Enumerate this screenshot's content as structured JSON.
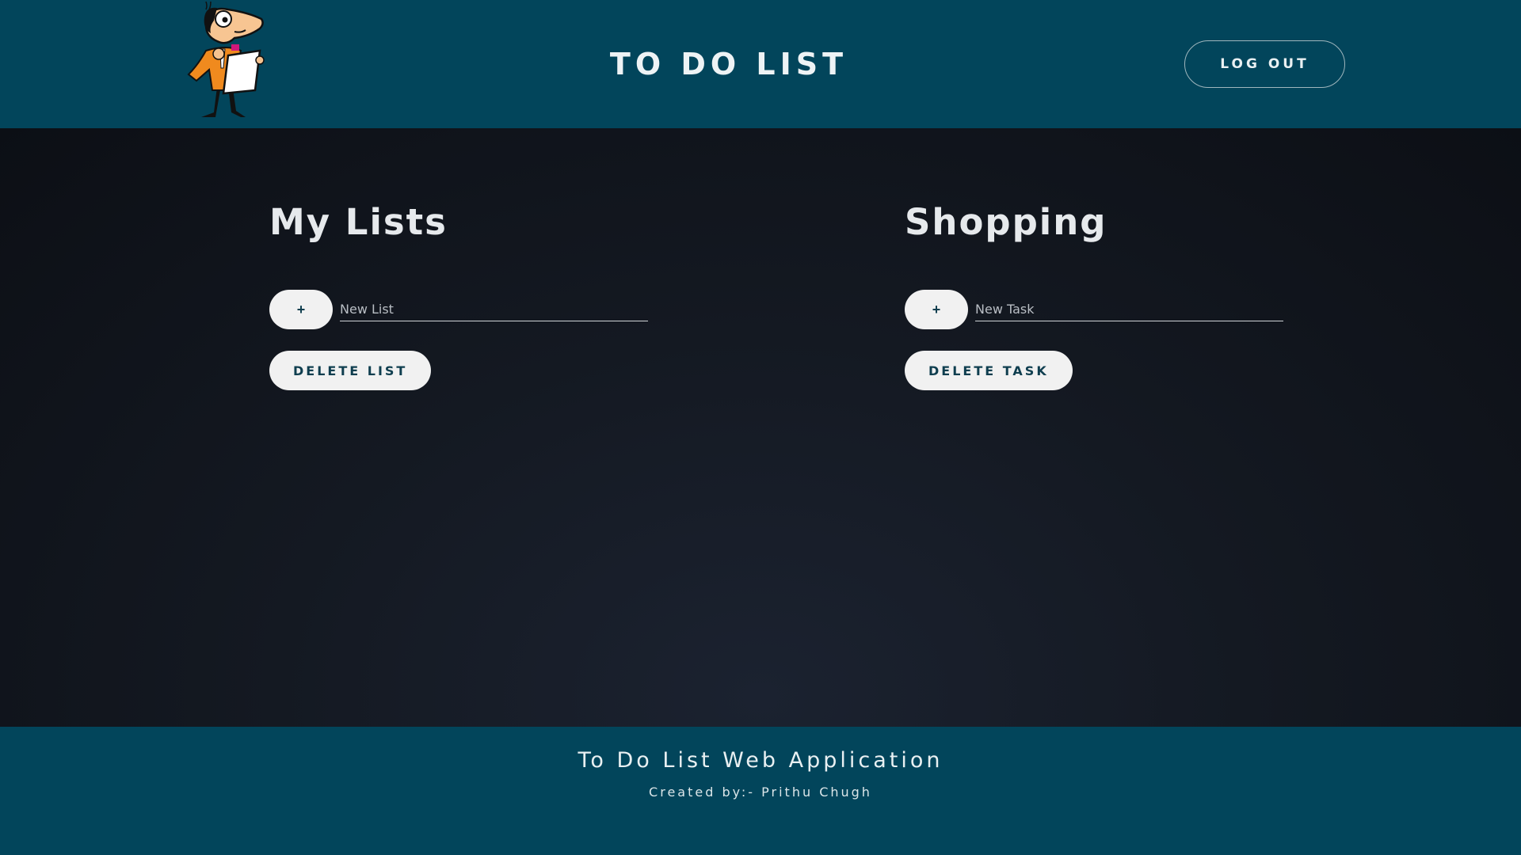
{
  "header": {
    "title": "TO DO LIST",
    "logout_label": "LOG OUT",
    "logo_icon": "cartoon-man-with-clipboard-icon"
  },
  "lists_panel": {
    "title": "My Lists",
    "add_label": "+",
    "input_placeholder": "New List",
    "input_value": "",
    "delete_label": "DELETE LIST"
  },
  "tasks_panel": {
    "title": "Shopping",
    "add_label": "+",
    "input_placeholder": "New Task",
    "input_value": "",
    "delete_label": "DELETE TASK"
  },
  "footer": {
    "title": "To Do List Web Application",
    "credit": "Created by:- Prithu Chugh"
  },
  "colors": {
    "header_bg": "#02455b",
    "footer_bg": "#02455b",
    "body_bg": "#141922",
    "button_bg": "#f1f1f1",
    "button_text": "#0f3e4f"
  }
}
